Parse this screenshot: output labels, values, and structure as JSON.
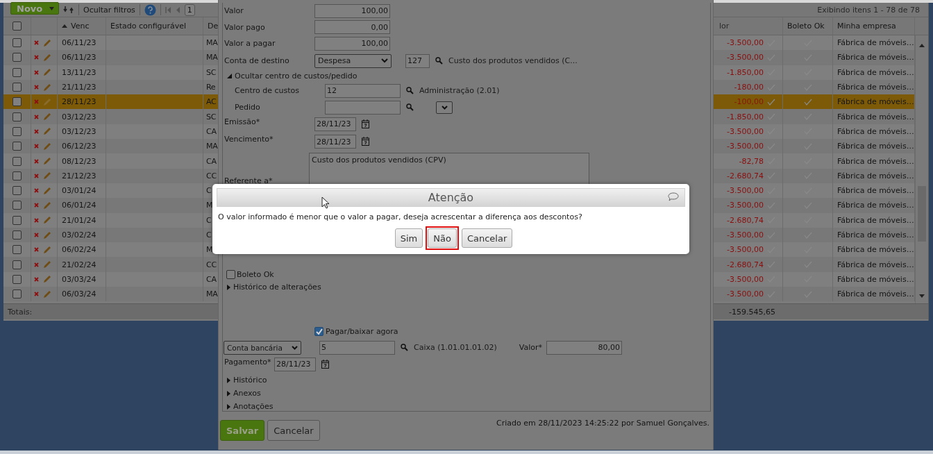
{
  "toolbar": {
    "new_button": "Novo",
    "filter_toggle": "Ocultar filtros",
    "page": "1",
    "summary": "Exibindo itens 1 - 78 de 78"
  },
  "table": {
    "all_checked": false,
    "columns": [
      "Venc",
      "Estado configurável",
      "De",
      "lor",
      "Boleto Ok",
      "Minha empresa"
    ],
    "rows": [
      {
        "checked": false,
        "selected": false,
        "venc": "06/11/23",
        "column_3": "MA",
        "column_4": "-3.500,00",
        "empresa": "Fábrica de móveis…"
      },
      {
        "checked": false,
        "selected": false,
        "venc": "06/11/23",
        "column_3": "MA",
        "column_4": "-3.500,00",
        "empresa": "Fábrica de móveis…"
      },
      {
        "checked": false,
        "selected": false,
        "venc": "13/11/23",
        "column_3": "SC",
        "column_4": "-1.850,00",
        "empresa": "Fábrica de móveis…"
      },
      {
        "checked": false,
        "selected": false,
        "venc": "21/11/23",
        "column_3": "Re",
        "column_4": "-180,00",
        "empresa": "Fábrica de móveis…"
      },
      {
        "checked": false,
        "selected": true,
        "venc": "28/11/23",
        "column_3": "AC",
        "column_4": "-100,00",
        "empresa": "Fábrica de móveis…"
      },
      {
        "checked": false,
        "selected": false,
        "venc": "03/12/23",
        "column_3": "SC",
        "column_4": "-1.850,00",
        "empresa": "Fábrica de móveis…"
      },
      {
        "checked": false,
        "selected": false,
        "venc": "03/12/23",
        "column_3": "CA",
        "column_4": "-3.500,00",
        "empresa": "Fábrica de móveis…"
      },
      {
        "checked": false,
        "selected": false,
        "venc": "06/12/23",
        "column_3": "MA",
        "column_4": "-3.500,00",
        "empresa": "Fábrica de móveis…"
      },
      {
        "checked": false,
        "selected": false,
        "venc": "08/12/23",
        "column_3": "CA",
        "column_4": "-82,78",
        "empresa": "Fábrica de móveis…"
      },
      {
        "checked": false,
        "selected": false,
        "venc": "21/12/23",
        "column_3": "CC",
        "column_4": "-2.680,74",
        "empresa": "Fábrica de móveis…"
      },
      {
        "checked": false,
        "selected": false,
        "venc": "03/01/24",
        "column_3": "C",
        "column_4": "-3.500,00",
        "empresa": "Fábrica de móveis…"
      },
      {
        "checked": false,
        "selected": false,
        "venc": "06/01/24",
        "column_3": "M",
        "column_4": "-3.500,00",
        "empresa": "Fábrica de móveis…"
      },
      {
        "checked": false,
        "selected": false,
        "venc": "21/01/24",
        "column_3": "C",
        "column_4": "-2.680,74",
        "empresa": "Fábrica de móveis…"
      },
      {
        "checked": false,
        "selected": false,
        "venc": "03/02/24",
        "column_3": "C",
        "column_4": "-3.500,00",
        "empresa": "Fábrica de móveis…"
      },
      {
        "checked": false,
        "selected": false,
        "venc": "06/02/24",
        "column_3": "M",
        "column_4": "-3.500,00",
        "empresa": "Fábrica de móveis…"
      },
      {
        "checked": false,
        "selected": false,
        "venc": "21/02/24",
        "column_3": "CC",
        "column_4": "-2.680,74",
        "empresa": "Fábrica de móveis…"
      },
      {
        "checked": false,
        "selected": false,
        "venc": "03/03/24",
        "column_3": "CA",
        "column_4": "-3.500,00",
        "empresa": "Fábrica de móveis…"
      },
      {
        "checked": false,
        "selected": false,
        "venc": "06/03/24",
        "column_3": "MA",
        "column_4": "-3.500,00",
        "empresa": "Fábrica de móveis…"
      }
    ],
    "totals_label": "Totais:",
    "total": "-159.545,65"
  },
  "form": {
    "amounts": [
      {
        "label": "Valor",
        "value": "100,00"
      },
      {
        "label": "Valor pago",
        "value": "0,00"
      },
      {
        "label": "Valor a pagar",
        "value": "100,00"
      }
    ],
    "account": {
      "label": "Conta de destino",
      "type": "Despesa",
      "code": "127",
      "name": "Custo dos produtos vendidos (C..."
    },
    "cost_toggle": {
      "label": "Ocultar centro de custos/pedido",
      "expanded": true
    },
    "cost_center": {
      "label": "Centro de custos",
      "value": "12",
      "name": "Administração (2.01)"
    },
    "order": {
      "label": "Pedido"
    },
    "issue": {
      "label": "Emissão*",
      "value": "28/11/23"
    },
    "due": {
      "label": "Vencimento*",
      "value": "28/11/23"
    },
    "reference": {
      "label": "Referente a*",
      "value": "Custo dos produtos vendidos (CPV)"
    },
    "boleto_ok": {
      "label": "Boleto Ok",
      "checked": false
    },
    "history_changes": {
      "label": "Histórico de alterações",
      "expanded": false
    },
    "pay_now": {
      "label": "Pagar/baixar agora",
      "checked": true
    },
    "bank": {
      "type": "Conta bancária",
      "code": "5",
      "name": "Caixa (1.01.01.01.02)",
      "amount_label": "Valor*",
      "amount": "80,00"
    },
    "payment": {
      "label": "Pagamento*",
      "value": "28/11/23"
    },
    "sections": [
      {
        "label": "Histórico",
        "expanded": false
      },
      {
        "label": "Anexos",
        "expanded": false
      },
      {
        "label": "Anotações",
        "expanded": false
      }
    ],
    "buttons": [
      {
        "label": "Salvar",
        "kind": "primary"
      },
      {
        "label": "Cancelar",
        "kind": "secondary"
      }
    ],
    "created": "Criado em 28/11/2023 14:25:22 por Samuel Gonçalves."
  },
  "dialog": {
    "title": "Atenção",
    "message": "O valor informado é menor que o valor a pagar, deseja acrescentar a diferença aos descontos?",
    "buttons": [
      {
        "label": "Sim",
        "highlighted": false
      },
      {
        "label": "Não",
        "highlighted": true
      },
      {
        "label": "Cancelar",
        "highlighted": false
      }
    ]
  }
}
